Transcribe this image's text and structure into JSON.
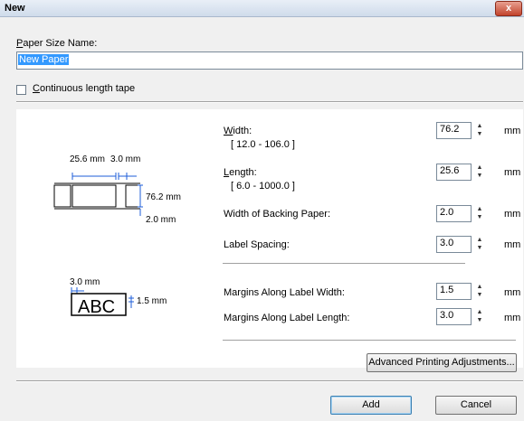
{
  "window": {
    "title": "New",
    "close_glyph": "x"
  },
  "paper_size_name": {
    "label": "Paper Size Name:",
    "value": "New Paper"
  },
  "continuous_tape": {
    "label": "Continuous length tape",
    "checked": false
  },
  "diagram": {
    "dim_25_6": "25.6 mm",
    "dim_3_0": "3.0 mm",
    "dim_76_2": "76.2 mm",
    "dim_2_0": "2.0 mm",
    "margin_3_0": "3.0 mm",
    "margin_1_5": "1.5 mm",
    "sample_text": "ABC"
  },
  "fields": {
    "width": {
      "label": "Width:",
      "range": "[ 12.0 - 106.0 ]",
      "value": "76.2",
      "unit": "mm"
    },
    "length": {
      "label": "Length:",
      "range": "[ 6.0 - 1000.0 ]",
      "value": "25.6",
      "unit": "mm"
    },
    "backing": {
      "label": "Width of Backing Paper:",
      "value": "2.0",
      "unit": "mm"
    },
    "spacing": {
      "label": "Label Spacing:",
      "value": "3.0",
      "unit": "mm"
    },
    "margin_width": {
      "label": "Margins Along Label Width:",
      "value": "1.5",
      "unit": "mm"
    },
    "margin_length": {
      "label": "Margins Along Label Length:",
      "value": "3.0",
      "unit": "mm"
    }
  },
  "buttons": {
    "advanced": "Advanced Printing Adjustments...",
    "add": "Add",
    "cancel": "Cancel"
  },
  "colors": {
    "accent": "#3399ff",
    "dim_line": "#1e5ed8",
    "close": "#c2432c"
  }
}
